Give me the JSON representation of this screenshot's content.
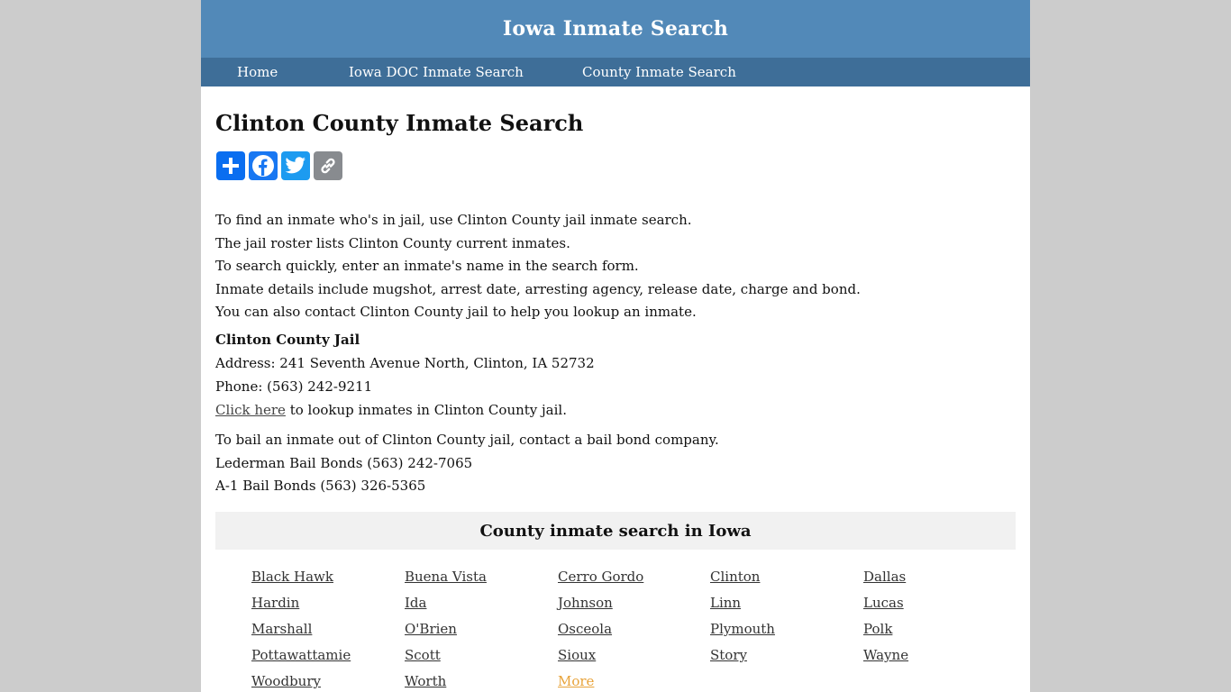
{
  "header": {
    "title": "Iowa Inmate Search"
  },
  "nav": [
    {
      "label": "Home"
    },
    {
      "label": "Iowa DOC Inmate Search"
    },
    {
      "label": "County Inmate Search"
    }
  ],
  "page_title": "Clinton County Inmate Search",
  "share": [
    "share-icon",
    "facebook-icon",
    "twitter-icon",
    "copy-link-icon"
  ],
  "intro": [
    "To find an inmate who's in jail, use Clinton County jail inmate search.",
    "The jail roster lists Clinton County current inmates.",
    "To search quickly, enter an inmate's name in the search form.",
    "Inmate details include mugshot, arrest date, arresting agency, release date, charge and bond.",
    "You can also contact Clinton County jail to help you lookup an inmate."
  ],
  "jail": {
    "name": "Clinton County Jail",
    "address": "Address: 241 Seventh Avenue North, Clinton, IA 52732",
    "phone": "Phone: (563) 242-9211"
  },
  "lookup": {
    "link": "Click here",
    "rest": " to lookup inmates in Clinton County jail."
  },
  "bail": [
    "To bail an inmate out of Clinton County jail, contact a bail bond company.",
    "Lederman Bail Bonds (563) 242-7065",
    "A-1 Bail Bonds (563) 326-5365"
  ],
  "counties_heading": "County inmate search in Iowa",
  "counties": [
    "Black Hawk",
    "Buena Vista",
    "Cerro Gordo",
    "Clinton",
    "Dallas",
    "Hardin",
    "Ida",
    "Johnson",
    "Linn",
    "Lucas",
    "Marshall",
    "O'Brien",
    "Osceola",
    "Plymouth",
    "Polk",
    "Pottawattamie",
    "Scott",
    "Sioux",
    "Story",
    "Wayne",
    "Woodbury",
    "Worth",
    "More"
  ],
  "colors": {
    "header": "#5289b8",
    "nav": "#3e6e98",
    "more_link": "#e8a33a"
  }
}
